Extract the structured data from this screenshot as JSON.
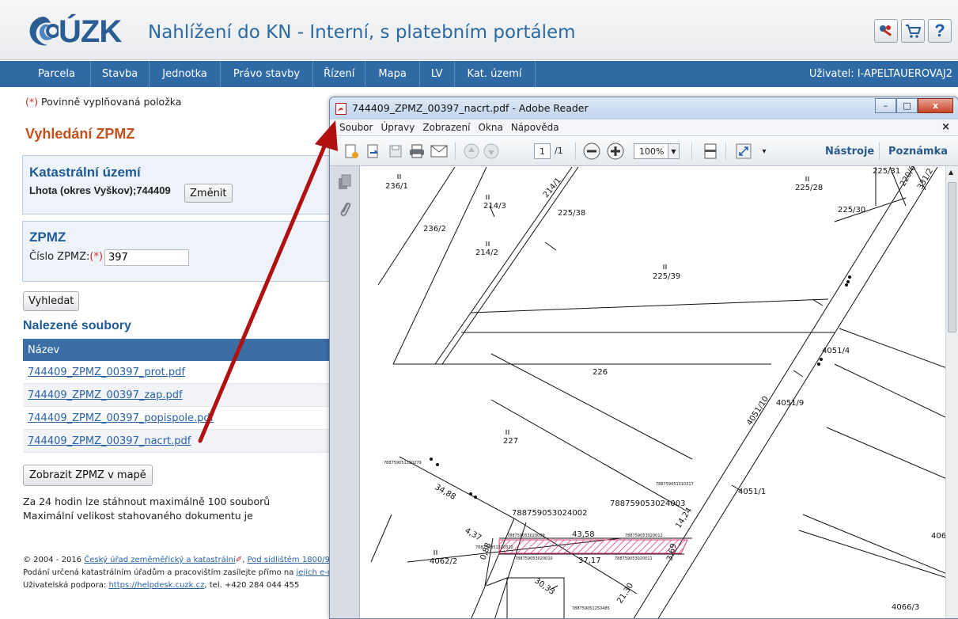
{
  "header": {
    "logo_text": "ÚZK",
    "site_title": "Nahlížení do KN - Interní, s platebním portálem",
    "icons": [
      "keys-icon",
      "cart-icon",
      "help-icon"
    ],
    "help_label": "?"
  },
  "nav": {
    "items": [
      "Parcela",
      "Stavba",
      "Jednotka",
      "Právo stavby",
      "Řízení",
      "Mapa",
      "LV",
      "Kat. území"
    ],
    "user": "Uživatel: I-APELTAUEROVAJ2"
  },
  "form": {
    "required_mark": "(*)",
    "required_note": " Povinně vyplňovaná položka",
    "heading": "Vyhledání ZPMZ",
    "ku_panel": {
      "title": "Katastrální území",
      "value": "Lhota (okres Vyškov);744409",
      "change_button": "Změnit"
    },
    "zpmz_panel": {
      "title": "ZPMZ",
      "field_label": "Číslo ZPMZ:",
      "required_mark": "(*)",
      "field_value": "397"
    },
    "search_button": "Vyhledat"
  },
  "results": {
    "heading": "Nalezené soubory",
    "column": "Název",
    "files": [
      "744409_ZPMZ_00397_prot.pdf",
      "744409_ZPMZ_00397_zap.pdf",
      "744409_ZPMZ_00397_popispole.pdf",
      "744409_ZPMZ_00397_nacrt.pdf"
    ],
    "map_button": "Zobrazit ZPMZ v mapě",
    "note1": "Za 24 hodin lze stáhnout maximálně 100 souborů",
    "note2": "Maximální velikost stahovaného dokumentu je"
  },
  "footer": {
    "line1_prefix": "© 2004 - 2016 ",
    "line1_link1": "Český úřad zeměměřický a katastrální",
    "line1_sep": ", ",
    "line1_link2": "Pod sídlištěm 1800/9, ",
    "line2_prefix": "Podání určená katastrálním úřadům a pracovištím zasílejte přímo na ",
    "line2_link": "jejich e-m",
    "line3_prefix": "Uživatelská podpora: ",
    "line3_link": "https://helpdesk.cuzk.cz",
    "line3_suffix": ", tel. +420 284 044 455"
  },
  "reader": {
    "title": "744409_ZPMZ_00397_nacrt.pdf - Adobe Reader",
    "menu": [
      "Soubor",
      "Úpravy",
      "Zobrazení",
      "Okna",
      "Nápověda"
    ],
    "menu_close": "×",
    "page_current": "1",
    "page_total": "/1",
    "zoom": "100%",
    "tools_label": "Nástroje",
    "comments_label": "Poznámka",
    "win_minimize": "–",
    "win_maximize": "□",
    "win_close": "x"
  },
  "sketch": {
    "labels": [
      "236/1",
      "236/2",
      "214/3",
      "214/2",
      "214/1",
      "225/38",
      "225/39",
      "225/28",
      "225/30",
      "225/31",
      "220/6",
      "331/2",
      "4051/4",
      "4051/10",
      "4051/9",
      "4051/1",
      "226",
      "227",
      "4062/2",
      "4066/",
      "4066/3",
      "788759053024003",
      "788759053024002",
      "43,58",
      "37,17",
      "34,88",
      "4,37",
      "0,88",
      "14,24",
      "3,69",
      "30,33",
      "21,30"
    ],
    "small_labels": [
      "788759051310279",
      "788759051310317",
      "788759053020009",
      "788759053020012",
      "788759053020010",
      "788759053020011",
      "788759051310320",
      "788759051250485"
    ],
    "accent": "#e0357a"
  },
  "colors": {
    "nav_bg": "#2f6aa5",
    "heading_orange": "#c2501a",
    "panel_title": "#1f5b95",
    "arrow": "#b01010"
  }
}
